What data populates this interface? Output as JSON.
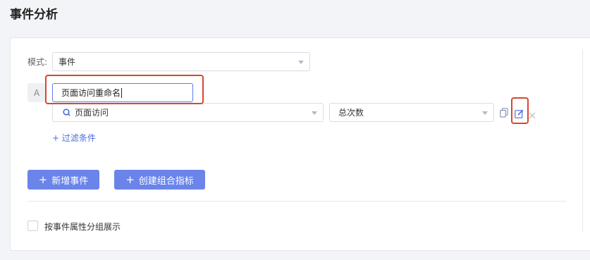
{
  "page": {
    "title": "事件分析"
  },
  "mode": {
    "label": "模式:",
    "value": "事件"
  },
  "event": {
    "badge": "A",
    "rename_value": "页面访问重命名",
    "event_value": "页面访问",
    "metric_value": "总次数",
    "filter_link": "+ 过滤条件"
  },
  "actions": {
    "add_event": "新增事件",
    "create_combo": "创建组合指标",
    "plus": "+"
  },
  "group": {
    "checkbox_label": "按事件属性分组展示",
    "checked": false
  },
  "icons": {
    "search": "search-icon",
    "copy": "copy-icon",
    "edit": "edit-icon",
    "close": "close-icon",
    "caret": "chevron-down-icon"
  },
  "colors": {
    "accent": "#6b84ea",
    "link": "#4a6fe0",
    "highlight": "#d9472b"
  }
}
